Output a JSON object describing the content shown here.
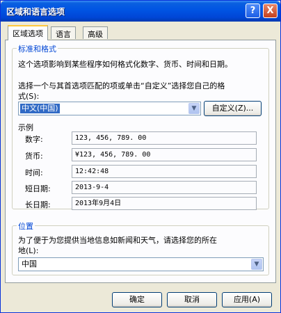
{
  "window": {
    "title": "区域和语言选项"
  },
  "title_buttons": {
    "help": "?",
    "close": "X"
  },
  "tabs": [
    {
      "label": "区域选项",
      "active": true
    },
    {
      "label": "语言",
      "active": false
    },
    {
      "label": "高级",
      "active": false
    }
  ],
  "standards": {
    "legend": "标准和格式",
    "description": "这个选项影响到某些程序如何格式化数字、货币、时间和日期。",
    "select_prompt_1": "选择一个与其首选项匹配的项或单击“自定义”选择您自己的格",
    "select_prompt_2": "式(S):",
    "locale_value": "中文(中国)",
    "customize_label": "自定义(Z)...",
    "samples_title": "示例",
    "samples": [
      {
        "label": "数字:",
        "value": "123, 456, 789. 00"
      },
      {
        "label": "货币:",
        "value": "¥123, 456, 789. 00"
      },
      {
        "label": "时间:",
        "value": "12:42:48"
      },
      {
        "label": "短日期:",
        "value": "2013-9-4"
      },
      {
        "label": "长日期:",
        "value": "2013年9月4日"
      }
    ]
  },
  "location": {
    "legend": "位置",
    "description_1": "为了便于为您提供当地信息如新闻和天气，请选择您的所在",
    "description_2": "地(L):",
    "value": "中国"
  },
  "footer": {
    "ok_label": "确定",
    "cancel_label": "取消",
    "apply_label": "应用(A)"
  },
  "colors": {
    "titlebar": "#0054e3",
    "group_legend": "#0046d5",
    "selection": "#316ac5"
  }
}
